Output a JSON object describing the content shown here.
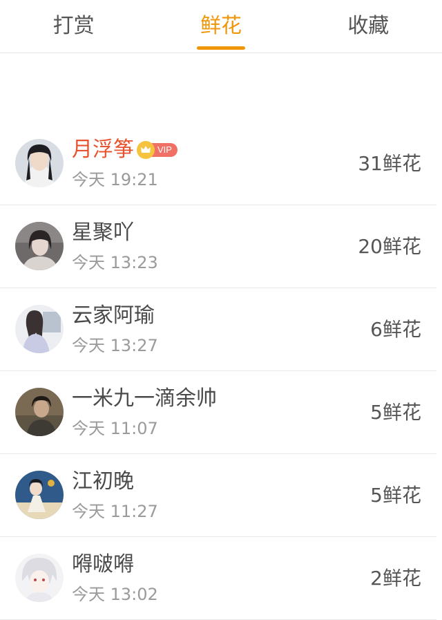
{
  "tabs": [
    {
      "label": "打赏",
      "active": false
    },
    {
      "label": "鲜花",
      "active": true
    },
    {
      "label": "收藏",
      "active": false
    }
  ],
  "accent_color": "#f0960a",
  "vip_badge_text": "VIP",
  "rows": [
    {
      "name": "月浮筝",
      "vip": true,
      "time": "今天 19:21",
      "count": "31鲜花"
    },
    {
      "name": "星聚吖",
      "vip": false,
      "time": "今天 13:23",
      "count": "20鲜花"
    },
    {
      "name": "云家阿瑜",
      "vip": false,
      "time": "今天 13:27",
      "count": "6鲜花"
    },
    {
      "name": "一米九一滴余帅",
      "vip": false,
      "time": "今天 11:07",
      "count": "5鲜花"
    },
    {
      "name": "江初晚",
      "vip": false,
      "time": "今天 11:27",
      "count": "5鲜花"
    },
    {
      "name": "嘚啵嘚",
      "vip": false,
      "time": "今天 13:02",
      "count": "2鲜花"
    }
  ]
}
